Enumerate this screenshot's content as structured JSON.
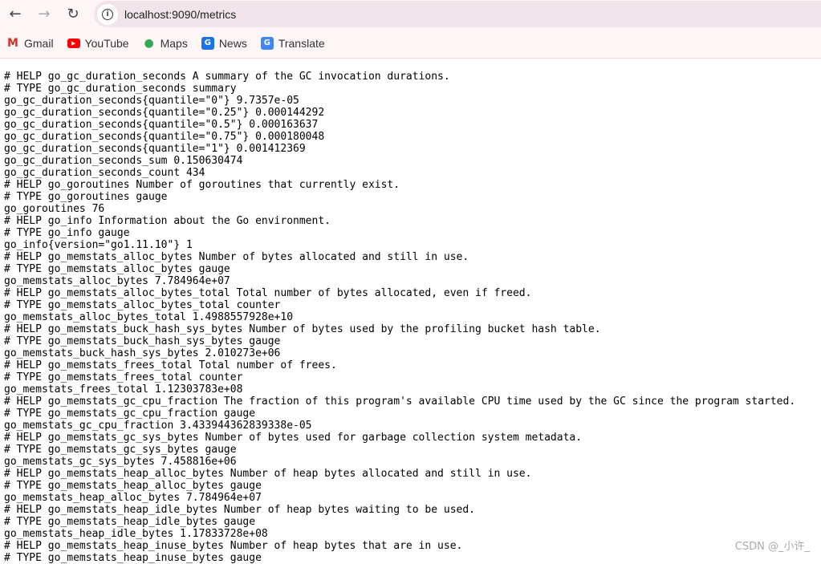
{
  "browser": {
    "url": "localhost:9090/metrics",
    "bookmarks": [
      {
        "label": "Gmail",
        "icon": "gmail-icon",
        "color": "#d93025"
      },
      {
        "label": "YouTube",
        "icon": "youtube-icon",
        "color": "#ff0000"
      },
      {
        "label": "Maps",
        "icon": "maps-icon",
        "color": "#34a853"
      },
      {
        "label": "News",
        "icon": "news-icon",
        "color": "#1a73e8"
      },
      {
        "label": "Translate",
        "icon": "translate-icon",
        "color": "#4285f4"
      }
    ]
  },
  "content": {
    "lines": [
      "# HELP go_gc_duration_seconds A summary of the GC invocation durations.",
      "# TYPE go_gc_duration_seconds summary",
      "go_gc_duration_seconds{quantile=\"0\"} 9.7357e-05",
      "go_gc_duration_seconds{quantile=\"0.25\"} 0.000144292",
      "go_gc_duration_seconds{quantile=\"0.5\"} 0.000163637",
      "go_gc_duration_seconds{quantile=\"0.75\"} 0.000180048",
      "go_gc_duration_seconds{quantile=\"1\"} 0.001412369",
      "go_gc_duration_seconds_sum 0.150630474",
      "go_gc_duration_seconds_count 434",
      "# HELP go_goroutines Number of goroutines that currently exist.",
      "# TYPE go_goroutines gauge",
      "go_goroutines 76",
      "# HELP go_info Information about the Go environment.",
      "# TYPE go_info gauge",
      "go_info{version=\"go1.11.10\"} 1",
      "# HELP go_memstats_alloc_bytes Number of bytes allocated and still in use.",
      "# TYPE go_memstats_alloc_bytes gauge",
      "go_memstats_alloc_bytes 7.784964e+07",
      "# HELP go_memstats_alloc_bytes_total Total number of bytes allocated, even if freed.",
      "# TYPE go_memstats_alloc_bytes_total counter",
      "go_memstats_alloc_bytes_total 1.4988557928e+10",
      "# HELP go_memstats_buck_hash_sys_bytes Number of bytes used by the profiling bucket hash table.",
      "# TYPE go_memstats_buck_hash_sys_bytes gauge",
      "go_memstats_buck_hash_sys_bytes 2.010273e+06",
      "# HELP go_memstats_frees_total Total number of frees.",
      "# TYPE go_memstats_frees_total counter",
      "go_memstats_frees_total 1.12303783e+08",
      "# HELP go_memstats_gc_cpu_fraction The fraction of this program's available CPU time used by the GC since the program started.",
      "# TYPE go_memstats_gc_cpu_fraction gauge",
      "go_memstats_gc_cpu_fraction 3.433944362839338e-05",
      "# HELP go_memstats_gc_sys_bytes Number of bytes used for garbage collection system metadata.",
      "# TYPE go_memstats_gc_sys_bytes gauge",
      "go_memstats_gc_sys_bytes 7.458816e+06",
      "# HELP go_memstats_heap_alloc_bytes Number of heap bytes allocated and still in use.",
      "# TYPE go_memstats_heap_alloc_bytes gauge",
      "go_memstats_heap_alloc_bytes 7.784964e+07",
      "# HELP go_memstats_heap_idle_bytes Number of heap bytes waiting to be used.",
      "# TYPE go_memstats_heap_idle_bytes gauge",
      "go_memstats_heap_idle_bytes 1.17833728e+08",
      "# HELP go_memstats_heap_inuse_bytes Number of heap bytes that are in use.",
      "# TYPE go_memstats_heap_inuse_bytes gauge"
    ]
  },
  "watermark": "CSDN @_小许_"
}
